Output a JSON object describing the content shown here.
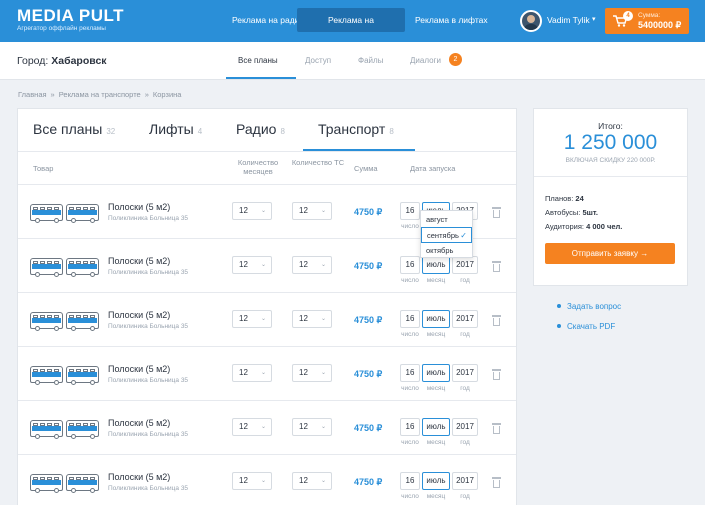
{
  "header": {
    "logo_title": "MEDIA PULT",
    "logo_subtitle": "Агрегатор оффлайн рекламы",
    "nav": [
      "Реклама на радио",
      "Реклама на транспорте",
      "Реклама в лифтах"
    ],
    "user_name": "Vadim Tylik",
    "cart_count": "4",
    "cart_label": "Сумма:",
    "cart_total": "5400000 ₽"
  },
  "subheader": {
    "city_label": "Город:",
    "city_value": "Хабаровск",
    "tabs": [
      "Все планы",
      "Доступ",
      "Файлы",
      "Диалоги"
    ],
    "dialogs_badge": "2"
  },
  "breadcrumbs": [
    "Главная",
    "Реклама на транспорте",
    "Корзина"
  ],
  "plans": {
    "tabs": [
      {
        "label": "Все планы",
        "count": "32"
      },
      {
        "label": "Лифты",
        "count": "4"
      },
      {
        "label": "Радио",
        "count": "8"
      },
      {
        "label": "Транспорт",
        "count": "8"
      }
    ],
    "columns": {
      "item": "Товар",
      "months": "Количество месяцев",
      "vehicles": "Количество ТС",
      "sum": "Сумма",
      "date": "Дата запуска"
    },
    "date_labels": {
      "day": "число",
      "month": "месяц",
      "year": "год"
    },
    "rows": [
      {
        "name": "Полоски (5 м2)",
        "sub": "Поликлиника Больница 35",
        "months": "12",
        "vehicles": "12",
        "price": "4750 ₽",
        "day": "16",
        "month": "июль",
        "year": "2017"
      },
      {
        "name": "Полоски (5 м2)",
        "sub": "Поликлиника Больница 35",
        "months": "12",
        "vehicles": "12",
        "price": "4750 ₽",
        "day": "16",
        "month": "июль",
        "year": "2017"
      },
      {
        "name": "Полоски (5 м2)",
        "sub": "Поликлиника Больница 35",
        "months": "12",
        "vehicles": "12",
        "price": "4750 ₽",
        "day": "16",
        "month": "июль",
        "year": "2017"
      },
      {
        "name": "Полоски (5 м2)",
        "sub": "Поликлиника Больница 35",
        "months": "12",
        "vehicles": "12",
        "price": "4750 ₽",
        "day": "16",
        "month": "июль",
        "year": "2017"
      },
      {
        "name": "Полоски (5 м2)",
        "sub": "Поликлиника Больница 35",
        "months": "12",
        "vehicles": "12",
        "price": "4750 ₽",
        "day": "16",
        "month": "июль",
        "year": "2017"
      },
      {
        "name": "Полоски (5 м2)",
        "sub": "Поликлиника Больница 35",
        "months": "12",
        "vehicles": "12",
        "price": "4750 ₽",
        "day": "16",
        "month": "июль",
        "year": "2017"
      }
    ],
    "month_dropdown": [
      "август",
      "сентябрь",
      "октябрь"
    ]
  },
  "summary": {
    "label": "Итого:",
    "total": "1 250 000",
    "discount_note": "ВКЛЮЧАЯ СКИДКУ 220 000Р.",
    "plans_label": "Планов:",
    "plans_value": "24",
    "buses_label": "Автобусы:",
    "buses_value": "5шт.",
    "audience_label": "Аудитория:",
    "audience_value": "4 000 чел.",
    "order_button": "Отправить заявку →"
  },
  "side_links": [
    "Задать вопрос",
    "Скачать PDF"
  ],
  "colors": {
    "brand": "#2a8fd8",
    "accent": "#f58220"
  }
}
